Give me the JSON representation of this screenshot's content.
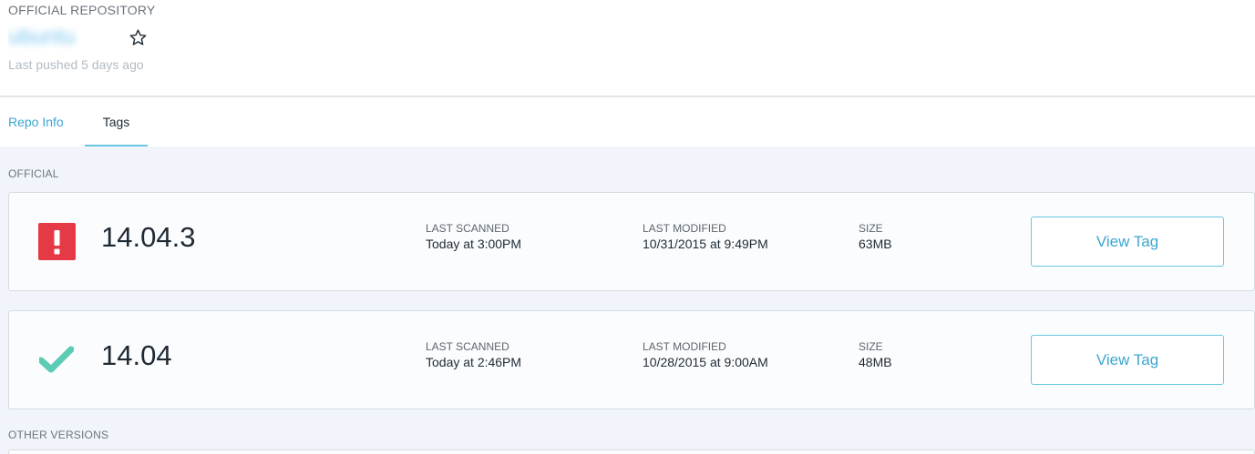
{
  "repo": {
    "kind_label": "OFFICIAL REPOSITORY",
    "name": "ubuntu",
    "last_pushed": "Last pushed 5 days ago"
  },
  "tabs": [
    {
      "label": "Repo Info",
      "active": false
    },
    {
      "label": "Tags",
      "active": true
    }
  ],
  "sections": {
    "official": "OFFICIAL",
    "other": "OTHER VERSIONS"
  },
  "tags": [
    {
      "name": "14.04.3",
      "status": "vulnerable",
      "status_icon": "alert-icon",
      "status_color": "#e53946",
      "last_scanned_label": "LAST SCANNED",
      "last_scanned": "Today at 3:00PM",
      "last_modified_label": "LAST MODIFIED",
      "last_modified": "10/31/2015 at 9:49PM",
      "size_label": "SIZE",
      "size": "63MB",
      "button_label": "View Tag"
    },
    {
      "name": "14.04",
      "status": "passed",
      "status_icon": "checkmark-icon",
      "status_color": "#5ccbb4",
      "last_scanned_label": "LAST SCANNED",
      "last_scanned": "Today at 2:46PM",
      "last_modified_label": "LAST MODIFIED",
      "last_modified": "10/28/2015 at 9:00AM",
      "size_label": "SIZE",
      "size": "48MB",
      "button_label": "View Tag"
    }
  ],
  "colors": {
    "accent": "#3ba6cf",
    "tab_underline": "#67c6e2",
    "content_bg": "#f1f5fb"
  }
}
